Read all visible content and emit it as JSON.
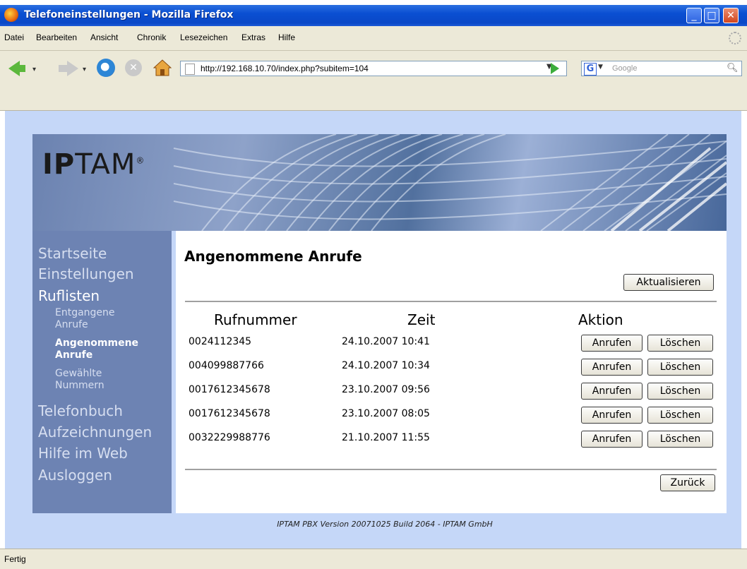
{
  "window": {
    "title": "Telefoneinstellungen - Mozilla Firefox",
    "controls": {
      "minimize": "_",
      "maximize": "□",
      "close": "✕"
    }
  },
  "menubar": {
    "items": [
      "Datei",
      "Bearbeiten",
      "Ansicht",
      "Chronik",
      "Lesezeichen",
      "Extras",
      "Hilfe"
    ]
  },
  "toolbar": {
    "url": "http://192.168.10.70/index.php?subitem=104",
    "search_placeholder": "Google",
    "icons": [
      "back-icon",
      "forward-icon",
      "reload-icon",
      "stop-icon",
      "home-icon",
      "go-icon",
      "google-icon",
      "search-icon"
    ]
  },
  "banner": {
    "logo_strong": "IP",
    "logo_light": "TAM",
    "logo_mark": "®"
  },
  "sidebar": {
    "main_items": [
      {
        "label": "Startseite",
        "active": false
      },
      {
        "label": "Einstellungen",
        "active": false
      },
      {
        "label": "Ruflisten",
        "active": true
      },
      {
        "label": "Telefonbuch",
        "active": false
      },
      {
        "label": "Aufzeichnungen",
        "active": false
      },
      {
        "label": "Hilfe im Web",
        "active": false
      },
      {
        "label": "Ausloggen",
        "active": false
      }
    ],
    "sub_items": [
      {
        "line1": "Entgangene",
        "line2": "Anrufe",
        "active": false
      },
      {
        "line1": "Angenommene",
        "line2": "Anrufe",
        "active": true
      },
      {
        "line1": "Gewählte",
        "line2": "Nummern",
        "active": false
      }
    ]
  },
  "main": {
    "heading": "Angenommene Anrufe",
    "refresh_label": "Aktualisieren",
    "back_label": "Zurück",
    "columns": [
      "Rufnummer",
      "Zeit",
      "Aktion"
    ],
    "call_label": "Anrufen",
    "delete_label": "Löschen",
    "rows": [
      {
        "number": "0024112345",
        "time": "24.10.2007 10:41"
      },
      {
        "number": "004099887766",
        "time": "24.10.2007 10:34"
      },
      {
        "number": "0017612345678",
        "time": "23.10.2007 09:56"
      },
      {
        "number": "0017612345678",
        "time": "23.10.2007 08:05"
      },
      {
        "number": "0032229988776",
        "time": "21.10.2007 11:55"
      }
    ]
  },
  "footer": "IPTAM PBX Version 20071025 Build 2064 - IPTAM GmbH",
  "status": "Fertig",
  "colors": {
    "sidebar_bg": "#6d83b3",
    "page_bg": "#c5d7f8",
    "titlebar": "#0a4fd2"
  }
}
